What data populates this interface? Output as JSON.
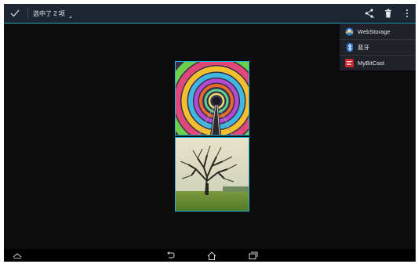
{
  "action_bar": {
    "done_icon": "checkmark-icon",
    "selection_text": "选中了 2 项",
    "share_icon": "share-icon",
    "delete_icon": "trash-icon",
    "overflow_icon": "overflow-menu-icon"
  },
  "share_menu": {
    "items": [
      {
        "label": "WebStorage",
        "icon": "webstorage-icon"
      },
      {
        "label": "蓝牙",
        "icon": "bluetooth-icon"
      },
      {
        "label": "MyBitCast",
        "icon": "mybitcast-icon"
      }
    ]
  },
  "gallery": {
    "selected_images": [
      {
        "description_icon": "tunnel-photo"
      },
      {
        "description_icon": "tree-photo"
      }
    ]
  },
  "nav_bar": {
    "buttons": [
      "up-icon",
      "back-icon",
      "home-icon",
      "recent-apps-icon"
    ]
  },
  "colors": {
    "action_bar_bg": "#1c2732",
    "accent": "#27b3d6",
    "screen_bg": "#0d0d0d",
    "menu_bg": "#1f2329"
  }
}
